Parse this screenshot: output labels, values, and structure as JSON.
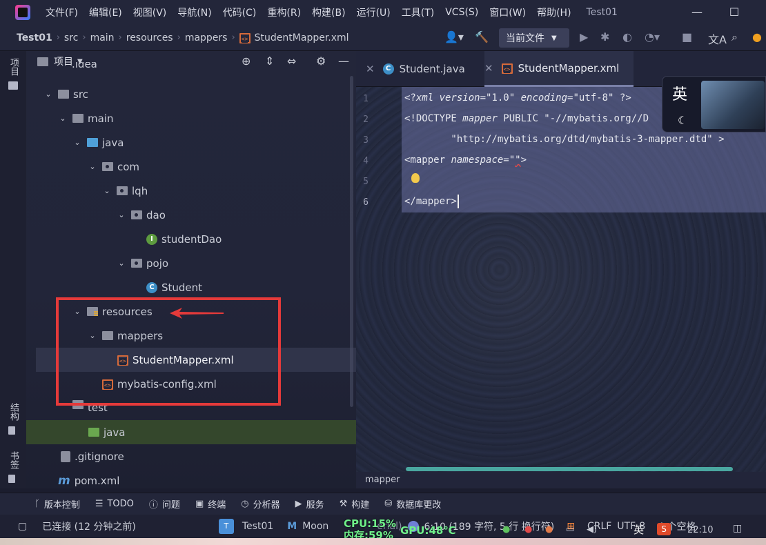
{
  "menubar": {
    "items": [
      "文件(F)",
      "编辑(E)",
      "视图(V)",
      "导航(N)",
      "代码(C)",
      "重构(R)",
      "构建(B)",
      "运行(U)",
      "工具(T)",
      "VCS(S)",
      "窗口(W)",
      "帮助(H)"
    ],
    "window_title": "Test01"
  },
  "breadcrumb": {
    "items": [
      "Test01",
      "src",
      "main",
      "resources",
      "mappers",
      "StudentMapper.xml"
    ]
  },
  "toolbar": {
    "run_config": "当前文件"
  },
  "left_strip": {
    "project_tab": "项目",
    "structure_tab": "结构",
    "bookmarks_tab": "书签"
  },
  "project_panel": {
    "title": "项目",
    "tree": [
      {
        "label": ".idea",
        "icon": "folder-icon"
      },
      {
        "label": "src",
        "icon": "folder-icon"
      },
      {
        "label": "main",
        "icon": "folder-icon"
      },
      {
        "label": "java",
        "icon": "source-folder-icon"
      },
      {
        "label": "com",
        "icon": "package-icon"
      },
      {
        "label": "lqh",
        "icon": "package-icon"
      },
      {
        "label": "dao",
        "icon": "package-icon"
      },
      {
        "label": "studentDao",
        "icon": "interface-icon"
      },
      {
        "label": "pojo",
        "icon": "package-icon"
      },
      {
        "label": "Student",
        "icon": "class-icon"
      },
      {
        "label": "resources",
        "icon": "resources-folder-icon"
      },
      {
        "label": "mappers",
        "icon": "folder-icon"
      },
      {
        "label": "StudentMapper.xml",
        "icon": "xml-file-icon"
      },
      {
        "label": "mybatis-config.xml",
        "icon": "xml-file-icon"
      },
      {
        "label": "test",
        "icon": "folder-icon"
      },
      {
        "label": "java",
        "icon": "test-folder-icon"
      },
      {
        "label": ".gitignore",
        "icon": "git-file-icon"
      },
      {
        "label": "pom.xml",
        "icon": "maven-icon"
      }
    ]
  },
  "editor": {
    "tabs": [
      {
        "label": "Student.java",
        "active": false
      },
      {
        "label": "StudentMapper.xml",
        "active": true
      }
    ],
    "line_numbers": [
      "1",
      "2",
      "3",
      "4",
      "5",
      "6"
    ],
    "lines": {
      "l1_a": "<?",
      "l1_b": "xml version",
      "l1_c": "=\"1.0\" ",
      "l1_d": "encoding",
      "l1_e": "=\"utf-8\" ?>",
      "l2_a": "<!DOCTYPE ",
      "l2_b": "mapper",
      "l2_c": " PUBLIC \"-//mybatis.org//D",
      "l3": "        \"http://mybatis.org/dtd/mybatis-3-mapper.dtd\" >",
      "l4_a": "<mapper ",
      "l4_b": "namespace",
      "l4_c": "=\"",
      "l4_d": "\"",
      "l4_e": ">",
      "l6": "</mapper>"
    },
    "ime_char": "英",
    "bottom_breadcrumb": "mapper"
  },
  "toolwindows": {
    "items": [
      {
        "label": "版本控制",
        "icon": "vcs-icon"
      },
      {
        "label": "TODO",
        "icon": "list-icon"
      },
      {
        "label": "问题",
        "icon": "problems-icon"
      },
      {
        "label": "终端",
        "icon": "terminal-icon"
      },
      {
        "label": "分析器",
        "icon": "profiler-icon"
      },
      {
        "label": "服务",
        "icon": "services-icon"
      },
      {
        "label": "构建",
        "icon": "build-icon"
      },
      {
        "label": "数据库更改",
        "icon": "database-icon"
      }
    ]
  },
  "statusbar": {
    "connection": "已连接 (12 分钟之前)",
    "project": "Test01",
    "theme": "Moon",
    "theme_suffix": "erial)",
    "position": "6:10 (189 字符, 5 行 换行符)",
    "line_sep": "CRLF",
    "encoding": "UTF-8",
    "indent": "4 个空格",
    "clock": "22:10",
    "ime": "英",
    "cpu": "CPU:15%",
    "mem": "内存:59%",
    "gpu": "GPU:48℃"
  },
  "colors": {
    "highlight": "#e53a3a",
    "accent_green": "#6ff08a"
  }
}
